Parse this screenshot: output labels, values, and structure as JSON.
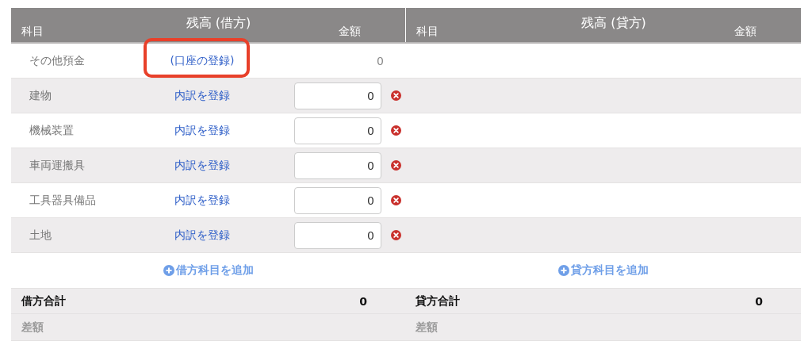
{
  "debit": {
    "title": "残高 (借方)",
    "col_account": "科目",
    "col_amount": "金額",
    "rows": [
      {
        "kind": "account",
        "name": "その他預金",
        "link": "(口座の登録)",
        "amount": "0",
        "highlighted": true
      },
      {
        "kind": "entry",
        "name": "建物",
        "link": "内訳を登録",
        "amount": "0",
        "highlighted": false
      },
      {
        "kind": "entry",
        "name": "機械装置",
        "link": "内訳を登録",
        "amount": "0",
        "highlighted": false
      },
      {
        "kind": "entry",
        "name": "車両運搬具",
        "link": "内訳を登録",
        "amount": "0",
        "highlighted": false
      },
      {
        "kind": "entry",
        "name": "工具器具備品",
        "link": "内訳を登録",
        "amount": "0",
        "highlighted": false
      },
      {
        "kind": "entry",
        "name": "土地",
        "link": "内訳を登録",
        "amount": "0",
        "highlighted": false
      }
    ],
    "add_label": "借方科目を追加",
    "total_label": "借方合計",
    "total": "0",
    "diff_label": "差額"
  },
  "credit": {
    "title": "残高 (貸方)",
    "col_account": "科目",
    "col_amount": "金額",
    "add_label": "貸方科目を追加",
    "total_label": "貸方合計",
    "total": "0",
    "diff_label": "差額"
  }
}
